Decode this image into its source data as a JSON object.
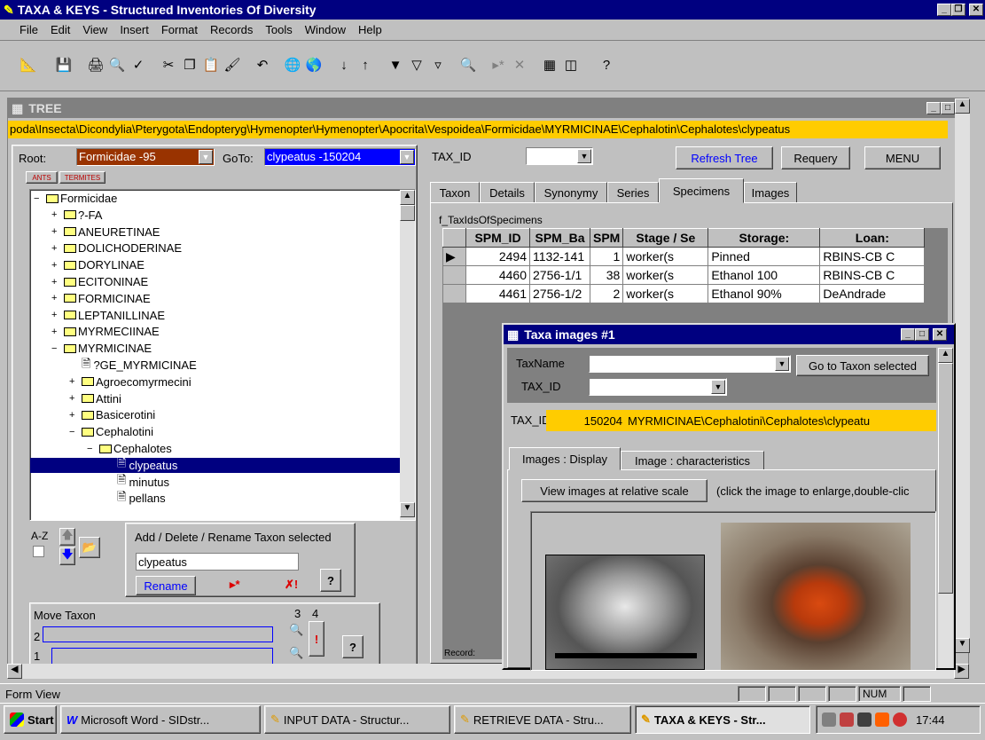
{
  "window": {
    "title": "TAXA & KEYS - Structured Inventories Of Diversity"
  },
  "menu": [
    "File",
    "Edit",
    "View",
    "Insert",
    "Format",
    "Records",
    "Tools",
    "Window",
    "Help"
  ],
  "tree_window": {
    "title": "TREE",
    "path": "poda\\Insecta\\Dicondylia\\Pterygota\\Endopteryg\\Hymenopter\\Hymenopter\\Apocrita\\Vespoidea\\Formicidae\\MYRMICINAE\\Cephalotin\\Cephalotes\\clypeatus",
    "root_label": "Root:",
    "root_value": "Formicidae -95",
    "goto_label": "GoTo:",
    "goto_value": "clypeatus -150204",
    "tab_ants": "ANTS",
    "tab_termites": "TERMITES",
    "tree": [
      {
        "label": "Formicidae",
        "level": 0,
        "icon": "folder-open"
      },
      {
        "label": "?-FA",
        "level": 1,
        "icon": "folder"
      },
      {
        "label": "ANEURETINAE",
        "level": 1,
        "icon": "folder"
      },
      {
        "label": "DOLICHODERINAE",
        "level": 1,
        "icon": "folder"
      },
      {
        "label": "DORYLINAE",
        "level": 1,
        "icon": "folder"
      },
      {
        "label": "ECITONINAE",
        "level": 1,
        "icon": "folder"
      },
      {
        "label": "FORMICINAE",
        "level": 1,
        "icon": "folder"
      },
      {
        "label": "LEPTANILLINAE",
        "level": 1,
        "icon": "folder"
      },
      {
        "label": "MYRMECIINAE",
        "level": 1,
        "icon": "folder"
      },
      {
        "label": "MYRMICINAE",
        "level": 1,
        "icon": "folder-open"
      },
      {
        "label": "?GE_MYRMICINAE",
        "level": 2,
        "icon": "doc"
      },
      {
        "label": "Agroecomyrmecini",
        "level": 2,
        "icon": "folder"
      },
      {
        "label": "Attini",
        "level": 2,
        "icon": "folder"
      },
      {
        "label": "Basicerotini",
        "level": 2,
        "icon": "folder"
      },
      {
        "label": "Cephalotini",
        "level": 2,
        "icon": "folder-open"
      },
      {
        "label": "Cephalotes",
        "level": 3,
        "icon": "folder-open"
      },
      {
        "label": "clypeatus",
        "level": 4,
        "icon": "doc",
        "selected": true
      },
      {
        "label": "minutus",
        "level": 4,
        "icon": "doc"
      },
      {
        "label": "pellans",
        "level": 4,
        "icon": "doc"
      }
    ],
    "az_label": "A-Z",
    "edit_title": "Add / Delete / Rename Taxon selected",
    "edit_value": "clypeatus",
    "rename_label": "Rename",
    "move_title": "Move Taxon",
    "move_nums": [
      "3",
      "4",
      "2",
      "1"
    ],
    "taxid_label": "TAX_ID",
    "refresh_label": "Refresh Tree",
    "requery_label": "Requery",
    "menu_label": "MENU",
    "tabs": [
      "Taxon",
      "Details",
      "Synonymy",
      "Series",
      "Specimens",
      "Images"
    ],
    "subform_label": "f_TaxIdsOfSpecimens",
    "columns": [
      "SPM_ID",
      "SPM_Ba",
      "SPM",
      "Stage / Se",
      "Storage:",
      "Loan:"
    ],
    "rows": [
      [
        "2494",
        "1132-141",
        "1",
        "worker(s",
        "Pinned",
        "RBINS-CB C"
      ],
      [
        "4460",
        "2756-1/1",
        "38",
        "worker(s",
        "Ethanol 100",
        "RBINS-CB C"
      ],
      [
        "4461",
        "2756-1/2",
        "2",
        "worker(s",
        "Ethanol 90%",
        "DeAndrade"
      ]
    ],
    "record_label": "Record:"
  },
  "images_window": {
    "title": "Taxa images #1",
    "taxname_label": "TaxName",
    "taxid_label": "TAX_ID",
    "goto_btn": "Go to Taxon selected",
    "taxid_display_label": "TAX_ID:",
    "taxid_value": "150204",
    "taxid_path": "MYRMICINAE\\Cephalotini\\Cephalotes\\clypeatu",
    "tab_display": "Images : Display",
    "tab_chars": "Image : characteristics",
    "view_btn": "View images at relative scale",
    "hint": "(click the image to enlarge,double-clic"
  },
  "status": {
    "text": "Form View",
    "num": "NUM"
  },
  "taskbar": {
    "start": "Start",
    "items": [
      "Microsoft Word - SIDstr...",
      "INPUT DATA - Structur...",
      "RETRIEVE DATA - Stru...",
      "TAXA & KEYS - Str..."
    ],
    "clock": "17:44"
  },
  "colors": {
    "title_active": "#000080",
    "path_bg": "#ffcc00",
    "root_bg": "#993300",
    "goto_bg": "#0000ff",
    "selected": "#000080"
  }
}
